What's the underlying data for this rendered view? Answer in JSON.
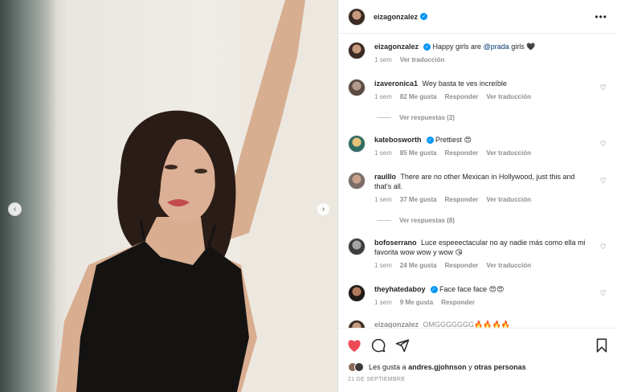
{
  "post": {
    "author": "eizagonzalez",
    "caption_text": "Happy girls are",
    "caption_mention": "@prada",
    "caption_end": "girls 🖤",
    "caption_time": "1 sem",
    "caption_translate": "Ver traducción"
  },
  "header": {
    "username": "eizagonzalez",
    "more_label": "•••"
  },
  "comments": [
    {
      "user": "izaveronica1",
      "text": "Wey basta te ves increíble",
      "time": "1 sem",
      "likes": "82 Me gusta",
      "reply": "Responder",
      "translate": "Ver traducción",
      "verified": false
    },
    {
      "user": "katebosworth",
      "text": "Prettiest 😍",
      "time": "1 sem",
      "likes": "85 Me gusta",
      "reply": "Responder",
      "translate": "Ver traducción",
      "verified": true
    },
    {
      "user": "raulllo",
      "text": "There are no other Mexican in Hollywood, just this and that's all.",
      "time": "1 sem",
      "likes": "37 Me gusta",
      "reply": "Responder",
      "translate": "Ver traducción",
      "verified": false
    },
    {
      "user": "bofoserrano",
      "text": "Luce espeeectacular no ay nadie más como ella mi favorita wow wow y wow 😘",
      "time": "1 sem",
      "likes": "24 Me gusta",
      "reply": "Responder",
      "translate": "Ver traducción",
      "verified": false
    },
    {
      "user": "theyhatedaboy",
      "text": "Face face face 😍😍",
      "time": "1 sem",
      "likes": "9 Me gusta",
      "reply": "Responder",
      "translate": "",
      "verified": true
    }
  ],
  "replies": [
    {
      "label": "Ver respuestas (2)"
    },
    {
      "label": "Ver respuestas (8)"
    }
  ],
  "partial_comment": {
    "user": "eizagonzalez",
    "text": "OMGGGGGGG🔥🔥🔥🔥"
  },
  "actions": {
    "liked_prefix": "Les gusta a",
    "liked_user": "andres.gjohnson",
    "liked_and": "y",
    "liked_others": "otras personas",
    "date": "21 DE SEPTIEMBRE"
  },
  "colors": {
    "like_red": "#ed4956",
    "verified_blue": "#0095f6",
    "mention_blue": "#00376b",
    "meta_gray": "#8e8e8e"
  },
  "icons": [
    "heart-filled-icon",
    "comment-icon",
    "share-icon",
    "bookmark-icon",
    "chevron-left-icon",
    "chevron-right-icon",
    "more-icon",
    "verified-icon",
    "heart-outline-icon"
  ]
}
